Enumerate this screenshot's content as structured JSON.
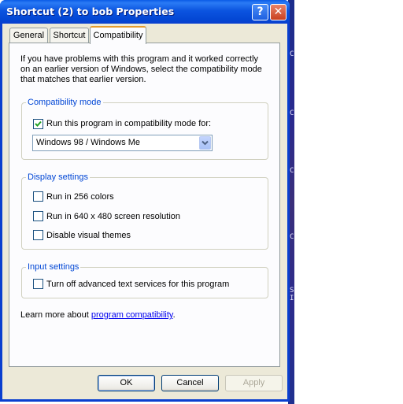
{
  "window": {
    "title": "Shortcut (2) to bob Properties",
    "help_label": "?",
    "close_label": "✕"
  },
  "tabs": [
    {
      "label": "General",
      "active": false
    },
    {
      "label": "Shortcut",
      "active": false
    },
    {
      "label": "Compatibility",
      "active": true
    }
  ],
  "intro_text": "If you have problems with this program and it worked correctly on an earlier version of Windows, select the compatibility mode that matches that earlier version.",
  "compatibility_mode": {
    "title": "Compatibility mode",
    "checkbox_label": "Run this program in compatibility mode for:",
    "checked": true,
    "selected_os": "Windows 98 / Windows Me"
  },
  "display_settings": {
    "title": "Display settings",
    "options": [
      {
        "label": "Run in 256 colors",
        "checked": false
      },
      {
        "label": "Run in 640 x 480 screen resolution",
        "checked": false
      },
      {
        "label": "Disable visual themes",
        "checked": false
      }
    ]
  },
  "input_settings": {
    "title": "Input settings",
    "options": [
      {
        "label": "Turn off advanced text services for this program",
        "checked": false
      }
    ]
  },
  "learn_more": {
    "prefix": "Learn more about ",
    "link_text": "program compatibility",
    "suffix": "."
  },
  "buttons": {
    "ok": "OK",
    "cancel": "Cancel",
    "apply": "Apply"
  },
  "desktop_glyphs": [
    "C",
    "C",
    "C",
    "C",
    "S",
    "I"
  ],
  "colors": {
    "titlebar": "#0b54e0",
    "group_title": "#0046d5",
    "active_tab_accent": "#e69c2e",
    "link": "#0000ee"
  }
}
